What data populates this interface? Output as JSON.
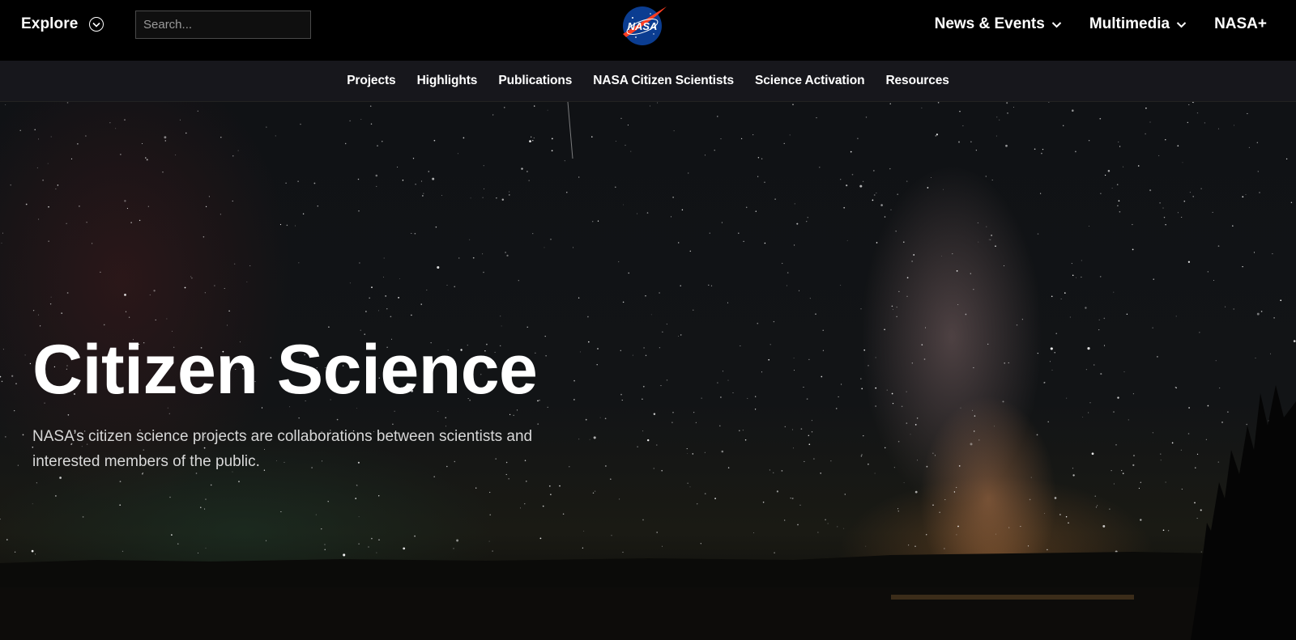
{
  "header": {
    "explore_label": "Explore",
    "search_placeholder": "Search...",
    "logo_text": "NASA",
    "nav": [
      {
        "label": "News & Events",
        "has_dropdown": true
      },
      {
        "label": "Multimedia",
        "has_dropdown": true
      },
      {
        "label": "NASA+",
        "has_dropdown": false
      }
    ]
  },
  "subnav": {
    "links": [
      "Projects",
      "Highlights",
      "Publications",
      "NASA Citizen Scientists",
      "Science Activation",
      "Resources"
    ]
  },
  "hero": {
    "title": "Citizen Science",
    "description": "NASA’s citizen science projects are collaborations between scientists and interested members of the public."
  },
  "colors": {
    "topbar_bg": "#000000",
    "subnav_bg": "#17171c",
    "nasa_blue": "#0b3d91",
    "nasa_red": "#fc3d21"
  }
}
